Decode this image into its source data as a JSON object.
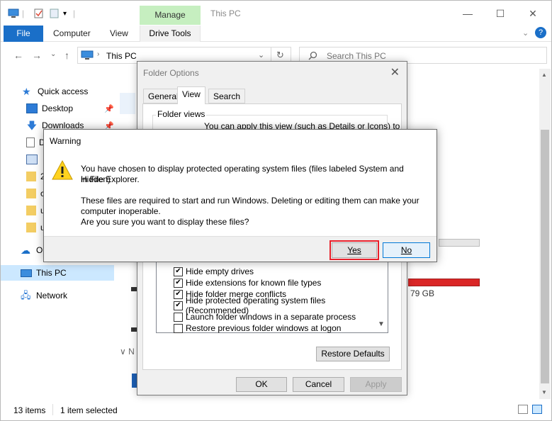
{
  "window": {
    "manage_tab": "Manage",
    "title": "This PC",
    "minimize": "—",
    "maximize": "☐",
    "close": "✕"
  },
  "ribbon": {
    "file": "File",
    "tabs": [
      "Computer",
      "View"
    ],
    "drive_tools": "Drive Tools",
    "help": "?"
  },
  "address": {
    "back": "←",
    "forward": "→",
    "recent": "⌄",
    "up": "↑",
    "path": "This PC",
    "path_dropdown": "⌄",
    "refresh": "↻",
    "search_placeholder": "Search This PC"
  },
  "navpane": {
    "quick_access": "Quick access",
    "desktop": "Desktop",
    "downloads": "Downloads",
    "partial_d1": "D",
    "partial_2": "2",
    "partial_c": "c",
    "partial_u1": "u",
    "partial_u2": "u",
    "onedrive": "Or",
    "this_pc": "This PC",
    "network": "Network"
  },
  "content": {
    "size_fragment": "79 GB",
    "group_caret": "∨ N"
  },
  "status": {
    "items": "13 items",
    "selected": "1 item selected"
  },
  "folder_options": {
    "title": "Folder Options",
    "tabs": [
      "General",
      "View",
      "Search"
    ],
    "group_label": "Folder views",
    "group_desc": "You can apply this view (such as Details or Icons) to",
    "checks": [
      {
        "label": "Hide empty drives",
        "checked": true
      },
      {
        "label": "Hide extensions for known file types",
        "checked": true
      },
      {
        "label": "Hide folder merge conflicts",
        "checked": true
      },
      {
        "label": "Hide protected operating system files (Recommended)",
        "checked": true
      },
      {
        "label": "Launch folder windows in a separate process",
        "checked": false
      },
      {
        "label": "Restore previous folder windows at logon",
        "checked": false
      }
    ],
    "restore_defaults": "Restore Defaults",
    "ok": "OK",
    "cancel": "Cancel",
    "apply": "Apply"
  },
  "warning": {
    "title": "Warning",
    "line1": "You have chosen to display protected operating system files (files labeled System and Hidden)",
    "line2": "in File Explorer.",
    "line3": "These files are required to start and run Windows. Deleting or editing them can make your",
    "line4": "computer inoperable.",
    "line5": "Are you sure you want to display these files?",
    "yes": "Yes",
    "no": "No"
  },
  "colors": {
    "accent": "#1a6fc8",
    "manage_green": "#c6efc0",
    "selection": "#cce8ff",
    "highlight_red": "#e8202a",
    "drive_bar_red": "#da2626"
  }
}
